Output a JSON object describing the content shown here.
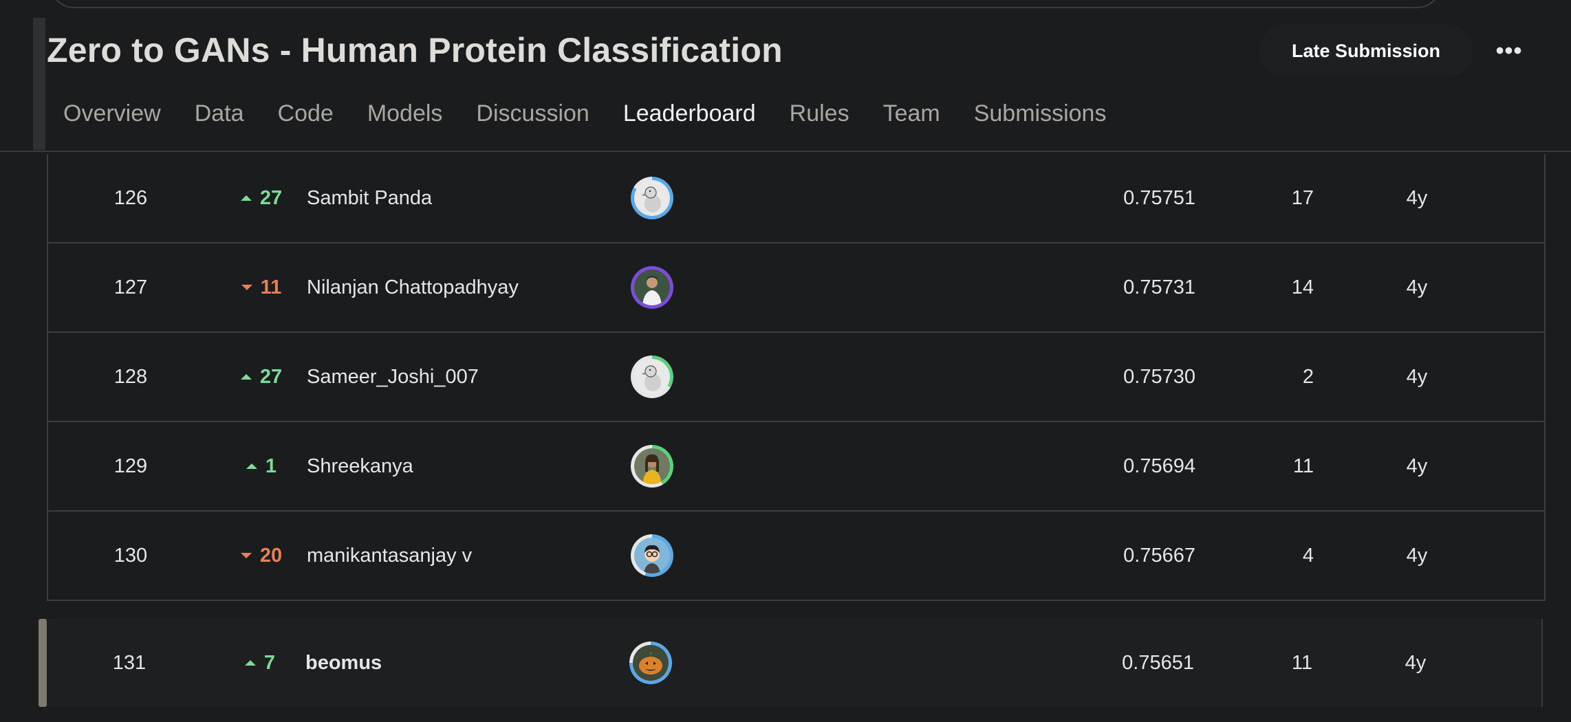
{
  "header": {
    "title": "Zero to GANs - Human Protein Classification",
    "late_submission_label": "Late Submission",
    "more_label": "•••"
  },
  "tabs": [
    {
      "label": "Overview"
    },
    {
      "label": "Data"
    },
    {
      "label": "Code"
    },
    {
      "label": "Models"
    },
    {
      "label": "Discussion"
    },
    {
      "label": "Leaderboard",
      "active": true
    },
    {
      "label": "Rules"
    },
    {
      "label": "Team"
    },
    {
      "label": "Submissions"
    }
  ],
  "leaderboard": {
    "rows": [
      {
        "rank": "126",
        "delta": "27",
        "direction": "up",
        "team": "Sambit Panda",
        "avatar": "goose-avatar",
        "ring": "#5aa9e6",
        "score": "0.75751",
        "entries": "17",
        "last": "4y"
      },
      {
        "rank": "127",
        "delta": "11",
        "direction": "down",
        "team": "Nilanjan Chattopadhyay",
        "avatar": "person-avatar",
        "ring": "#7c4ddb",
        "score": "0.75731",
        "entries": "14",
        "last": "4y"
      },
      {
        "rank": "128",
        "delta": "27",
        "direction": "up",
        "team": "Sameer_Joshi_007",
        "avatar": "goose-avatar",
        "ring": "#5ad17a",
        "score": "0.75730",
        "entries": "2",
        "last": "4y"
      },
      {
        "rank": "129",
        "delta": "1",
        "direction": "up",
        "team": "Shreekanya",
        "avatar": "person-avatar",
        "ring": "#5ad17a",
        "score": "0.75694",
        "entries": "11",
        "last": "4y"
      },
      {
        "rank": "130",
        "delta": "20",
        "direction": "down",
        "team": "manikantasanjay v",
        "avatar": "cartoon-avatar",
        "ring": "#5aa9e6",
        "score": "0.75667",
        "entries": "4",
        "last": "4y"
      }
    ],
    "own_row": {
      "rank": "131",
      "delta": "7",
      "direction": "up",
      "team": "beomus",
      "avatar": "pumpkin-avatar",
      "ring": "#5aa9e6",
      "score": "0.75651",
      "entries": "11",
      "last": "4y"
    }
  }
}
